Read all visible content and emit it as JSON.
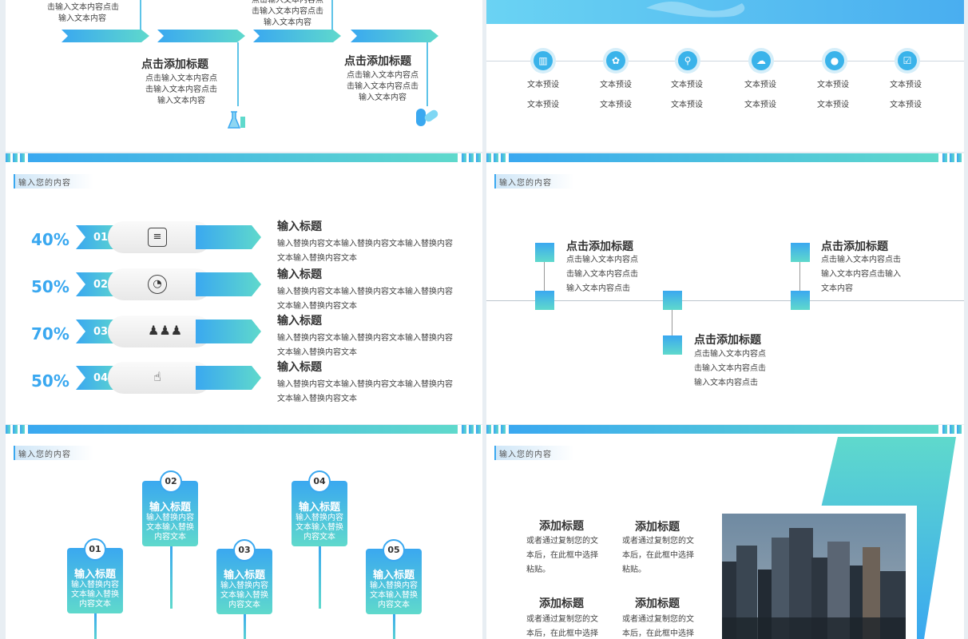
{
  "slide1": {
    "top_left_text": [
      "击输入文本内容点击",
      "输入文本内容"
    ],
    "top_mid_text": [
      "点击输入文本内容点",
      "击输入文本内容点击",
      "输入文本内容"
    ],
    "block1": {
      "title": "点击添加标题",
      "lines": [
        "点击输入文本内容点",
        "击输入文本内容点击",
        "输入文本内容"
      ]
    },
    "block2": {
      "title": "点击添加标题",
      "lines": [
        "点击输入文本内容点",
        "击输入文本内容点击",
        "输入文本内容"
      ]
    },
    "icons": [
      "flask-icon",
      "pill-icon"
    ]
  },
  "slide2": {
    "icons": [
      "building-icon",
      "plant-icon",
      "search-icon",
      "weather-icon",
      "user-icon",
      "checklist-icon"
    ],
    "row1": [
      "文本预设",
      "文本预设",
      "文本预设",
      "文本预设",
      "文本预设",
      "文本预设"
    ],
    "row2": [
      "文本预设",
      "文本预设",
      "文本预设",
      "文本预设",
      "文本预设",
      "文本预设"
    ]
  },
  "slide3": {
    "tag": "输入您的内容",
    "rows": [
      {
        "pct": "40%",
        "num": "01",
        "icon": "document-icon",
        "title": "输入标题",
        "line1": "输入替换内容文本输入替换内容文本输入替换内容",
        "line2": "文本输入替换内容文本"
      },
      {
        "pct": "50%",
        "num": "02",
        "icon": "pie-chart-icon",
        "title": "输入标题",
        "line1": "输入替换内容文本输入替换内容文本输入替换内容",
        "line2": "文本输入替换内容文本"
      },
      {
        "pct": "70%",
        "num": "03",
        "icon": "team-icon",
        "title": "输入标题",
        "line1": "输入替换内容文本输入替换内容文本输入替换内容",
        "line2": "文本输入替换内容文本"
      },
      {
        "pct": "50%",
        "num": "04",
        "icon": "hand-icon",
        "title": "输入标题",
        "line1": "输入替换内容文本输入替换内容文本输入替换内容",
        "line2": "文本输入替换内容文本"
      }
    ]
  },
  "slide4": {
    "tag": "输入您的内容",
    "b1": {
      "title": "点击添加标题",
      "lines": [
        "点击输入文本内容点",
        "击输入文本内容点击",
        "输入文本内容点击"
      ]
    },
    "b2": {
      "title": "点击添加标题",
      "lines": [
        "点击输入文本内容点击",
        "输入文本内容点击输入",
        "文本内容"
      ]
    },
    "b3": {
      "title": "点击添加标题",
      "lines": [
        "点击输入文本内容点",
        "击输入文本内容点击",
        "输入文本内容点击"
      ]
    }
  },
  "slide5": {
    "tag": "输入您的内容",
    "cards": [
      {
        "num": "01",
        "title": "输入标题",
        "lines": [
          "输入替换内容",
          "文本输入替换",
          "内容文本"
        ]
      },
      {
        "num": "02",
        "title": "输入标题",
        "lines": [
          "输入替换内容",
          "文本输入替换",
          "内容文本"
        ]
      },
      {
        "num": "03",
        "title": "输入标题",
        "lines": [
          "输入替换内容",
          "文本输入替换",
          "内容文本"
        ]
      },
      {
        "num": "04",
        "title": "输入标题",
        "lines": [
          "输入替换内容",
          "文本输入替换",
          "内容文本"
        ]
      },
      {
        "num": "05",
        "title": "输入标题",
        "lines": [
          "输入替换内容",
          "文本输入替换",
          "内容文本"
        ]
      }
    ]
  },
  "slide6": {
    "tag": "输入您的内容",
    "items": [
      {
        "title": "添加标题",
        "lines": [
          "或者通过复制您的文",
          "本后，在此框中选择",
          "粘贴。"
        ]
      },
      {
        "title": "添加标题",
        "lines": [
          "或者通过复制您的文",
          "本后，在此框中选择",
          "粘贴。"
        ]
      },
      {
        "title": "添加标题",
        "lines": [
          "或者通过复制您的文",
          "本后，在此框中选择"
        ]
      },
      {
        "title": "添加标题",
        "lines": [
          "或者通过复制您的文",
          "本后，在此框中选择"
        ]
      }
    ],
    "photo": "city-skyline-photo"
  }
}
